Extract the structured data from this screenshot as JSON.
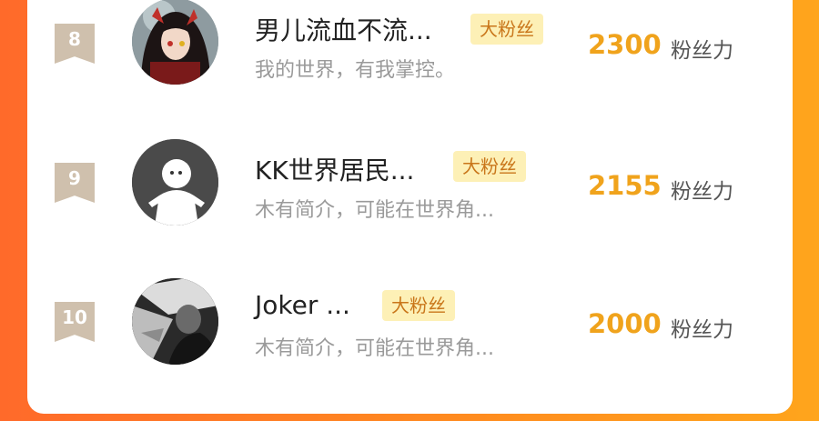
{
  "rows": [
    {
      "rank": "8",
      "name": "男儿流血不流...",
      "badge": "大粉丝",
      "bio": "我的世界，有我掌控。",
      "score": "2300",
      "unit": "粉丝力"
    },
    {
      "rank": "9",
      "name": "KK世界居民...",
      "badge": "大粉丝",
      "bio": "木有简介，可能在世界角...",
      "score": "2155",
      "unit": "粉丝力"
    },
    {
      "rank": "10",
      "name": "Joker  ...",
      "badge": "大粉丝",
      "bio": "木有简介，可能在世界角...",
      "score": "2000",
      "unit": "粉丝力"
    }
  ],
  "colors": {
    "accent": "#f0a31c",
    "badge_bg": "#fdf0b6",
    "badge_text": "#c9761a",
    "rank_bg": "#cfc0ad"
  }
}
